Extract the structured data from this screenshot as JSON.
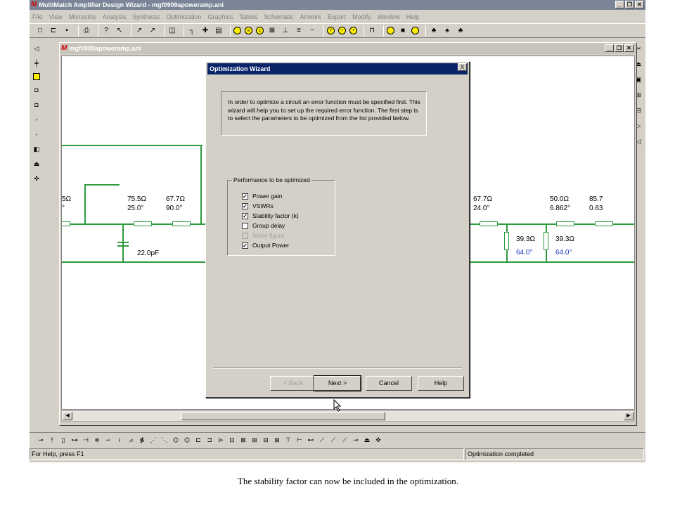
{
  "app": {
    "title": "MultiMatch Amplifier Design Wizard - mgf0909apoweramp.ani",
    "logo_letter": "M"
  },
  "window_controls": {
    "minimize": "_",
    "restore": "❐",
    "close": "✕"
  },
  "menu": [
    "File",
    "View",
    "Microstrip",
    "Analysis",
    "Synthesis",
    "Optimization",
    "Graphics",
    "Tables",
    "Schematic",
    "Artwork",
    "Export",
    "Modify",
    "Window",
    "Help"
  ],
  "toolbar_icons": [
    "new-icon",
    "open-icon",
    "save-icon",
    "print-icon",
    "help-icon",
    "context-help-icon",
    "draw-icon",
    "draw-alt-icon",
    "component-icon",
    "tee-icon",
    "cross-icon",
    "box-icon",
    "circle-icon",
    "circle-e-icon",
    "circle-c-icon",
    "x-box-icon",
    "ground-icon",
    "bus-icon",
    "wave-icon",
    "y-icon",
    "ratio-icon",
    "dot-icon",
    "graph-icon",
    "ring-icon",
    "square-icon",
    "ellipse-icon",
    "people-icon",
    "person-icon",
    "group-icon"
  ],
  "mdi": {
    "title": "mgf0909apoweramp.ani"
  },
  "schematic": {
    "labels_left": [
      {
        "z": "5Ω",
        "deg": "°"
      },
      {
        "z": "75.5Ω",
        "deg": "25.0°"
      },
      {
        "z": "67.7Ω",
        "deg": "90.0°"
      },
      {
        "z": "5",
        "deg": "2"
      }
    ],
    "capacitor": "22.0pF",
    "labels_right": [
      {
        "z": "67.7Ω",
        "deg": "24.0°"
      },
      {
        "z": "50.0Ω",
        "deg": "6.862°"
      },
      {
        "z": "85.7",
        "deg": "0.63"
      }
    ],
    "stubs": [
      {
        "z": "39.3Ω",
        "deg": "64.0°"
      },
      {
        "z": "39.3Ω",
        "deg": "64.0°"
      }
    ],
    "colors": {
      "wire": "#2e9b3e",
      "stub_label": "#1a37c8"
    }
  },
  "dialog": {
    "title": "Optimization Wizard",
    "close": "X",
    "intro": "In order to optimize a circuit an error function must be specified first. This wizard will help you to set up the required error function. The first step is to select the parameters to be optimized from the list provided below.",
    "group_label": "Performance to be optimized",
    "options": [
      {
        "label": "Power gain",
        "checked": "✓",
        "enabled": true
      },
      {
        "label": "VSWRs",
        "checked": "✓",
        "enabled": true
      },
      {
        "label": "Stability factor (k)",
        "checked": "✓",
        "enabled": true
      },
      {
        "label": "Group delay",
        "checked": "",
        "enabled": true
      },
      {
        "label": "Noise figure",
        "checked": "",
        "enabled": false
      },
      {
        "label": "Output Power",
        "checked": "✓",
        "enabled": true
      }
    ],
    "buttons": {
      "back": "< Back",
      "next": "Next >",
      "cancel": "Cancel",
      "help": "Help"
    }
  },
  "scroll": {
    "left": "◀",
    "right": "▶"
  },
  "status": {
    "help": "For Help, press F1",
    "message": "Optimization completed"
  },
  "caption": "The stability factor can now be included in the optimization."
}
